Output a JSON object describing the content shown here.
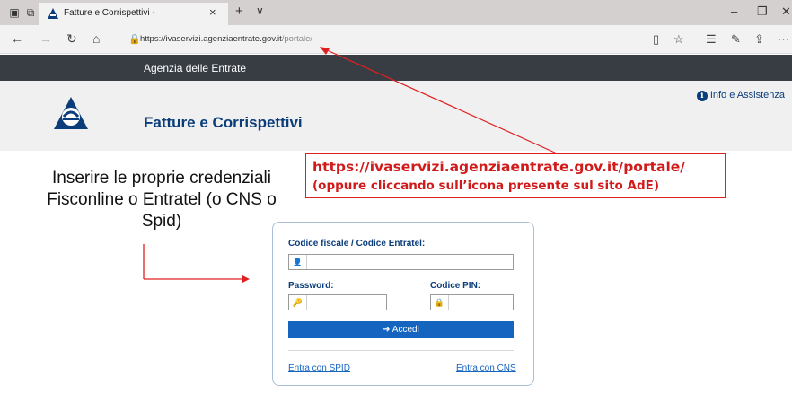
{
  "browser": {
    "tab_title": "Fatture e Corrispettivi -",
    "tab_close": "×",
    "new_tab": "+",
    "tab_dropdown": "∨",
    "url_host": "https://ivaservizi.agenziaentrate.gov.it",
    "url_path": "/portale/"
  },
  "site": {
    "top_bar_title": "Agenzia delle Entrate",
    "service_title": "Fatture e Corrispettivi",
    "info_label": "Info e Assistenza",
    "brand_color": "#0a3d7a"
  },
  "annotation": {
    "url": "https://ivaservizi.agenziaentrate.gov.it/portale/",
    "note": "(oppure cliccando sull’icona presente sul sito AdE)",
    "instructions": "Inserire le proprie credenziali Fisconline o Entratel (o CNS o Spid)",
    "color": "#d11a1a"
  },
  "login": {
    "codice_fiscale_label": "Codice fiscale / Codice Entratel:",
    "password_label": "Password:",
    "pin_label": "Codice PIN:",
    "submit_label": "Accedi",
    "spid_link": "Entra con SPID",
    "cns_link": "Entra con CNS",
    "button_color": "#1565c0"
  }
}
